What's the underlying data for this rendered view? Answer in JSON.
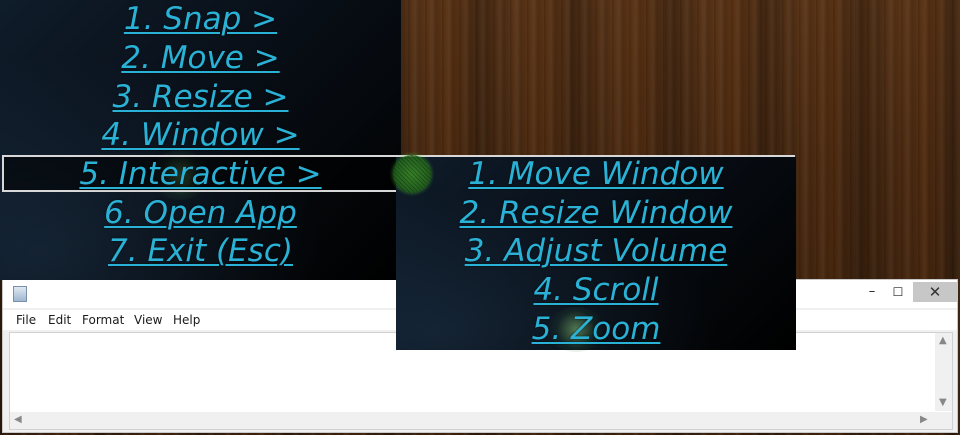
{
  "main_menu": {
    "items": [
      {
        "label": "1. Snap >"
      },
      {
        "label": "2. Move >"
      },
      {
        "label": "3. Resize >"
      },
      {
        "label": "4. Window >"
      },
      {
        "label": "5. Interactive >"
      },
      {
        "label": "6. Open App"
      },
      {
        "label": "7. Exit (Esc)"
      }
    ],
    "selected_index": 4
  },
  "sub_menu": {
    "items": [
      {
        "label": "1. Move Window"
      },
      {
        "label": "2. Resize Window"
      },
      {
        "label": "3. Adjust Volume"
      },
      {
        "label": "4. Scroll"
      },
      {
        "label": "5. Zoom"
      }
    ]
  },
  "notepad": {
    "menu": {
      "file": "File",
      "edit": "Edit",
      "format": "Format",
      "view": "View",
      "help": "Help"
    },
    "buttons": {
      "minimize": "–",
      "maximize": "☐",
      "close": "✕"
    },
    "content": ""
  },
  "colors": {
    "menu_text": "#2ab2d6",
    "highlight_border": "#d8d8d8",
    "cursor": "#3c8c28"
  },
  "icons": [
    "notepad-icon",
    "gaze-cursor-icon"
  ]
}
